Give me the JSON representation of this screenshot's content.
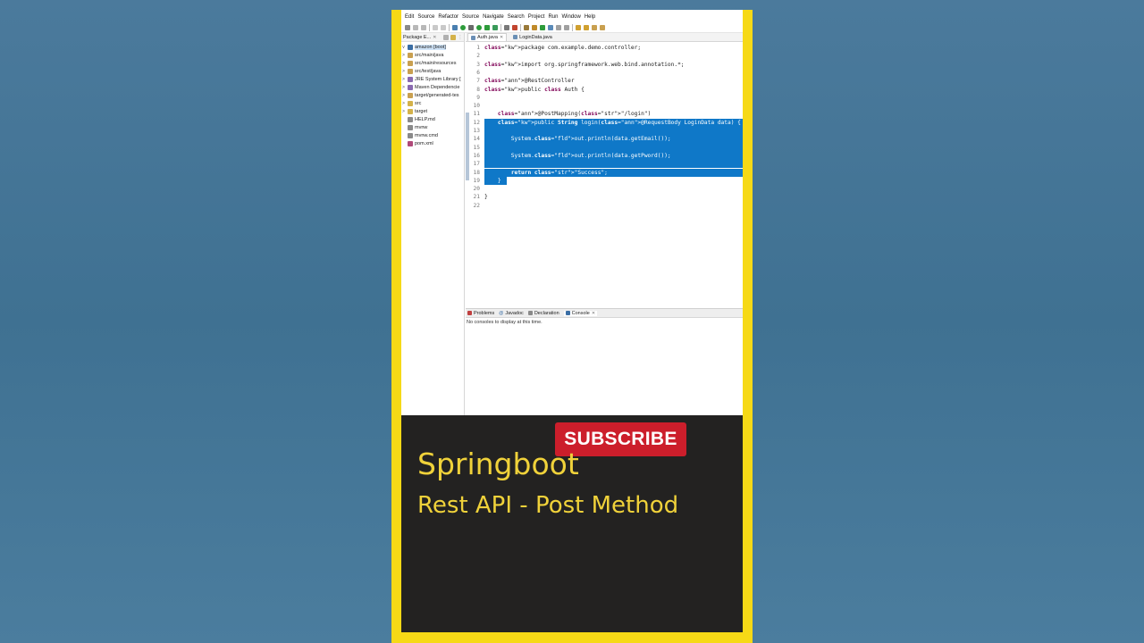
{
  "menu": [
    "Edit",
    "Source",
    "Refactor",
    "Source",
    "Navigate",
    "Search",
    "Project",
    "Run",
    "Window",
    "Help"
  ],
  "package_explorer": {
    "title": "Package E...",
    "items": [
      {
        "label": "amazon [boot]",
        "twisty": "v",
        "selected": true
      },
      {
        "label": "src/main/java",
        "twisty": ">"
      },
      {
        "label": "src/main/resources",
        "twisty": ">"
      },
      {
        "label": "src/test/java",
        "twisty": ">"
      },
      {
        "label": "JRE System Library [",
        "twisty": ">"
      },
      {
        "label": "Maven Dependencie",
        "twisty": ">"
      },
      {
        "label": "target/generated-tes",
        "twisty": ">"
      },
      {
        "label": "src",
        "twisty": ">"
      },
      {
        "label": "target",
        "twisty": ">"
      },
      {
        "label": "HELP.md",
        "twisty": ""
      },
      {
        "label": "mvnw",
        "twisty": ""
      },
      {
        "label": "mvnw.cmd",
        "twisty": ""
      },
      {
        "label": "pom.xml",
        "twisty": ""
      }
    ]
  },
  "editor": {
    "tabs": [
      {
        "label": "Auth.java",
        "active": true
      },
      {
        "label": "LoginData.java",
        "active": false
      }
    ],
    "lines": [
      {
        "n": "1",
        "code": "package com.example.demo.controller;"
      },
      {
        "n": "2",
        "code": ""
      },
      {
        "n": "3",
        "code": "import org.springframework.web.bind.annotation.*;"
      },
      {
        "n": "6",
        "code": ""
      },
      {
        "n": "7",
        "code": "@RestController"
      },
      {
        "n": "8",
        "code": "public class Auth {"
      },
      {
        "n": "9",
        "code": ""
      },
      {
        "n": "10",
        "code": ""
      },
      {
        "n": "11",
        "code": "    @PostMapping(\"/login\")"
      },
      {
        "n": "12",
        "code": "    public String login(@RequestBody LoginData data) {"
      },
      {
        "n": "13",
        "code": ""
      },
      {
        "n": "14",
        "code": "        System.out.println(data.getEmail());"
      },
      {
        "n": "15",
        "code": ""
      },
      {
        "n": "16",
        "code": "        System.out.println(data.getPword());"
      },
      {
        "n": "17",
        "code": ""
      },
      {
        "n": "18",
        "code": "        return \"Success\";"
      },
      {
        "n": "19",
        "code": "    }"
      },
      {
        "n": "20",
        "code": ""
      },
      {
        "n": "21",
        "code": "}"
      },
      {
        "n": "22",
        "code": ""
      }
    ]
  },
  "console": {
    "tabs": [
      "Problems",
      "Javadoc",
      "Declaration",
      "Console"
    ],
    "active_tab": "Console",
    "message": "No consoles to display at this time."
  },
  "banner": {
    "subscribe_label": "SUBSCRIBE",
    "title": "Springboot",
    "subtitle": "Rest API - Post Method"
  },
  "colors": {
    "frame": "#f6d916",
    "selection": "#0f78c8",
    "subscribe": "#cc1e2b",
    "banner_text": "#f0d23a",
    "banner_bg": "#232221"
  }
}
